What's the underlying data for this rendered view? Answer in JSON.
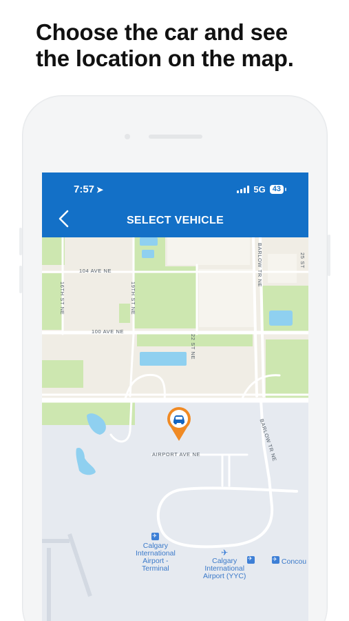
{
  "headline": {
    "line1": "Choose the car and see",
    "line2": "the location on the map."
  },
  "status_bar": {
    "time": "7:57",
    "location_icon": "location-arrow-icon",
    "network": "5G",
    "battery": "43"
  },
  "app_bar": {
    "back_icon": "chevron-left-icon",
    "title": "SELECT VEHICLE"
  },
  "map": {
    "street_labels": {
      "ave_104": "104 AVE NE",
      "ave_100": "100 AVE NE",
      "st_16": "16TH ST NE",
      "st_19": "19TH ST NE",
      "st_22": "22 ST NE",
      "barlow_top": "BARLOW TR NE",
      "st_25": "25 ST",
      "barlow_bottom": "BARLOW TR NE",
      "airport_ave": "AIRPORT AVE NE"
    },
    "pois": {
      "terminal": "Calgary International Airport - Terminal",
      "terminal_lines": [
        "Calgary",
        "International",
        "Airport -",
        "Terminal"
      ],
      "yyc_lines": [
        "Calgary",
        "International",
        "Airport (YYC)"
      ],
      "concourse": "Concou"
    },
    "vehicle_marker_icon": "car-icon",
    "colors": {
      "land": "#f0ede5",
      "park": "#cde7b0",
      "airport": "#e6eaf0",
      "water": "#8fd0f0",
      "road": "#ffffff",
      "pin": "#f08a24"
    }
  }
}
